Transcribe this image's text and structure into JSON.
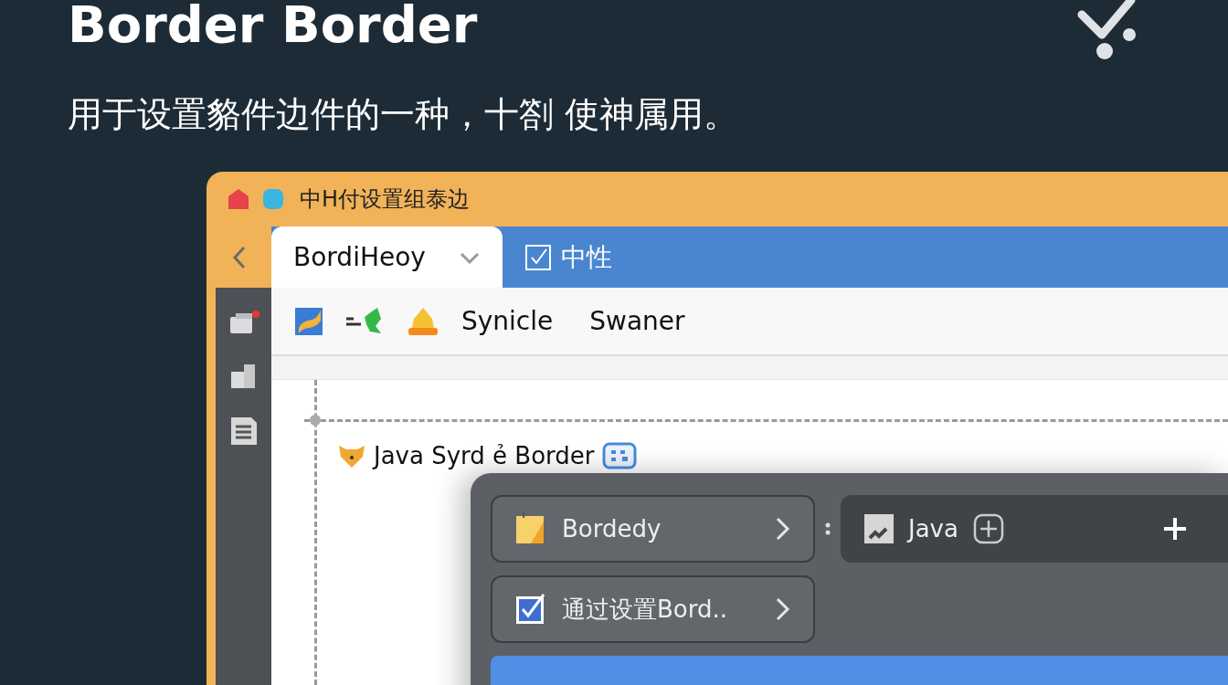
{
  "heading": {
    "title": "Border Border",
    "subtitle": "用于设置貉件边件的一种，十劄 使神属用。"
  },
  "window": {
    "title": "中H付设置组泰边"
  },
  "tabs": [
    {
      "label": "BordiHeoy",
      "selected": true
    },
    {
      "label": "中性",
      "selected": false
    }
  ],
  "toolbar": [
    {
      "label": "Synicle"
    },
    {
      "label": "Swaner"
    }
  ],
  "canvas": {
    "label": "Java Syrd ẻ Border"
  },
  "menu": [
    {
      "kind": "note",
      "label": "Bordedy",
      "selected": false
    },
    {
      "kind": "check",
      "label": "通过设置Bord..",
      "selected": false
    },
    {
      "kind": "blank",
      "selected": true
    }
  ],
  "field": {
    "value": "Java"
  }
}
